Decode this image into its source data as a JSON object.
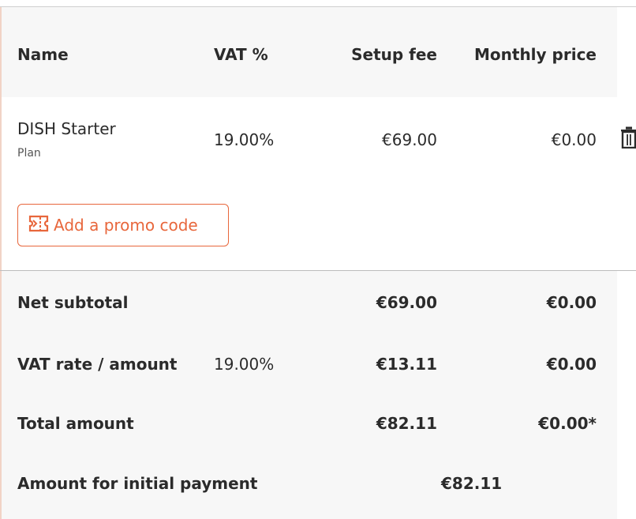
{
  "columns": {
    "name": "Name",
    "vat": "VAT %",
    "setup_fee": "Setup fee",
    "monthly_price": "Monthly price"
  },
  "item": {
    "name": "DISH Starter",
    "type": "Plan",
    "vat": "19.00%",
    "setup_fee": "€69.00",
    "monthly_price": "€0.00",
    "delete_icon": "trash-icon"
  },
  "promo": {
    "label": "Add a promo code",
    "icon": "ticket-icon"
  },
  "totals": {
    "net_subtotal": {
      "label": "Net subtotal",
      "setup_fee": "€69.00",
      "monthly_price": "€0.00"
    },
    "vat": {
      "label": "VAT rate / amount",
      "rate": "19.00%",
      "setup_fee": "€13.11",
      "monthly_price": "€0.00"
    },
    "total": {
      "label": "Total amount",
      "setup_fee": "€82.11",
      "monthly_price": "€0.00*"
    },
    "initial_payment": {
      "label": "Amount for initial payment",
      "amount": "€82.11"
    }
  },
  "colors": {
    "accent": "#e8673c",
    "band": "#f7f7f7",
    "text": "#2b2b2b"
  }
}
